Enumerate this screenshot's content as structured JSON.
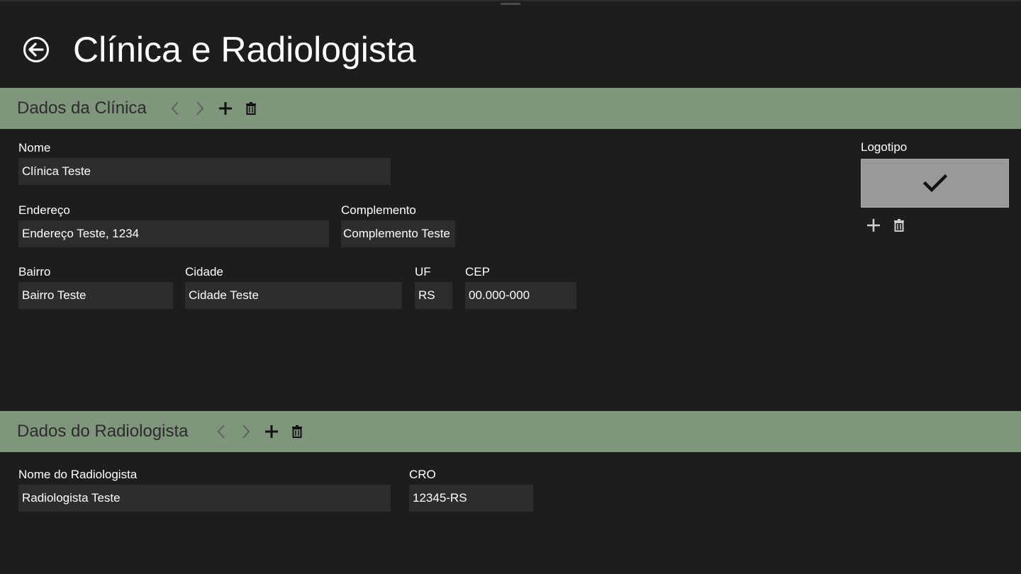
{
  "header": {
    "title": "Clínica e Radiologista",
    "back_icon": "back-arrow-circle-icon"
  },
  "colors": {
    "background": "#1d1d1d",
    "section_bar": "#80967c",
    "input_background": "#2e2d2e",
    "logo_box": "#999999"
  },
  "clinic": {
    "section_title": "Dados da Clínica",
    "toolbar_icons": [
      "chevron-left-icon",
      "chevron-right-icon",
      "plus-icon",
      "trash-icon"
    ],
    "fields": {
      "nome": {
        "label": "Nome",
        "value": "Clínica Teste"
      },
      "endereco": {
        "label": "Endereço",
        "value": "Endereço Teste, 1234"
      },
      "complemento": {
        "label": "Complemento",
        "value": "Complemento Teste"
      },
      "bairro": {
        "label": "Bairro",
        "value": "Bairro Teste"
      },
      "cidade": {
        "label": "Cidade",
        "value": "Cidade Teste"
      },
      "uf": {
        "label": "UF",
        "value": "RS"
      },
      "cep": {
        "label": "CEP",
        "value": "00.000-000"
      }
    },
    "logo": {
      "label": "Logotipo",
      "icon": "checkmark-icon",
      "action_icons": [
        "plus-icon",
        "trash-icon"
      ]
    }
  },
  "radiologist": {
    "section_title": "Dados do Radiologista",
    "toolbar_icons": [
      "chevron-left-icon",
      "chevron-right-icon",
      "plus-icon",
      "trash-icon"
    ],
    "fields": {
      "nome": {
        "label": "Nome do Radiologista",
        "value": "Radiologista Teste"
      },
      "cro": {
        "label": "CRO",
        "value": "12345-RS"
      }
    }
  }
}
